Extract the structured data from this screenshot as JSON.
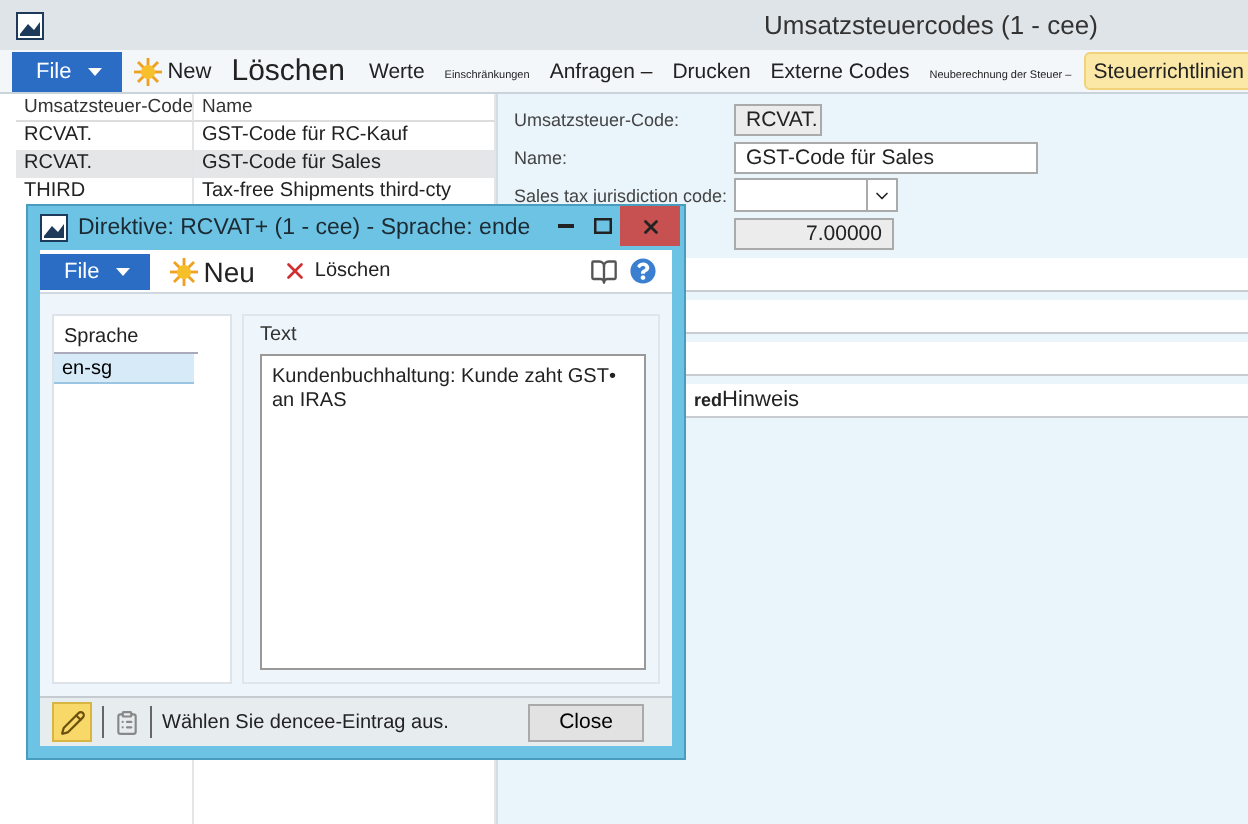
{
  "window": {
    "title": "Umsatzsteuercodes (1 - cee)"
  },
  "ribbon": {
    "items": [
      {
        "kind": "file",
        "label": "File",
        "selected": false
      },
      {
        "kind": "new",
        "label": "New",
        "selected": false
      },
      {
        "kind": "large",
        "label": "Löschen",
        "selected": false
      },
      {
        "kind": "plain",
        "label": "Werte",
        "selected": false
      },
      {
        "kind": "tiny",
        "label": "Einschränkungen",
        "selected": false
      },
      {
        "kind": "plain",
        "label": "Anfragen –",
        "selected": false
      },
      {
        "kind": "plain",
        "label": "Drucken",
        "selected": false
      },
      {
        "kind": "plain",
        "label": "Externe Codes",
        "selected": false
      },
      {
        "kind": "tiny",
        "label": "Neuberechnung der Steuer –",
        "selected": false
      },
      {
        "kind": "plain",
        "label": "Steuerrichtlinien",
        "selected": true
      }
    ]
  },
  "grid": {
    "columns": [
      "Umsatzsteuer-Code",
      "Name"
    ],
    "rows": [
      {
        "cells": [
          "RCVAT.",
          "GST-Code für RC-Kauf"
        ],
        "selected": false
      },
      {
        "cells": [
          "RCVAT.",
          "GST-Code für Sales"
        ],
        "selected": true
      },
      {
        "cells": [
          "THIRD",
          "Tax-free Shipments third-cty"
        ],
        "selected": false
      }
    ]
  },
  "form": {
    "fields": [
      {
        "kind": "readonly",
        "label": "Umsatzsteuer-Code:",
        "value": "RCVAT."
      },
      {
        "kind": "text",
        "label": "Name:",
        "value": "GST-Code für Sales"
      },
      {
        "kind": "dropdown",
        "label": "Sales tax jurisdiction code:"
      },
      {
        "kind": "number",
        "value": "7.00000"
      }
    ],
    "sections": [
      {
        "kind": "blank"
      },
      {
        "kind": "blank"
      },
      {
        "kind": "blank"
      },
      {
        "kind": "labeled",
        "label": "red",
        "text": "Hinweis"
      }
    ]
  },
  "dialog": {
    "title": "Direktive: RCVAT+ (1 - cee) - Sprache: ende",
    "toolbar": [
      {
        "kind": "file",
        "label": "File"
      },
      {
        "kind": "new",
        "label": "Neu"
      },
      {
        "kind": "delete",
        "label": "Löschen"
      }
    ],
    "list": {
      "header": "Sprache",
      "items": [
        {
          "label": "en-sg",
          "selected": true
        }
      ]
    },
    "text_group": {
      "label": "Text",
      "value": "Kundenbuchhaltung: Kunde zaht GST•\nan IRAS"
    },
    "status": {
      "message": "Wählen Sie dencee-Eintrag aus.",
      "button": "Close"
    }
  }
}
